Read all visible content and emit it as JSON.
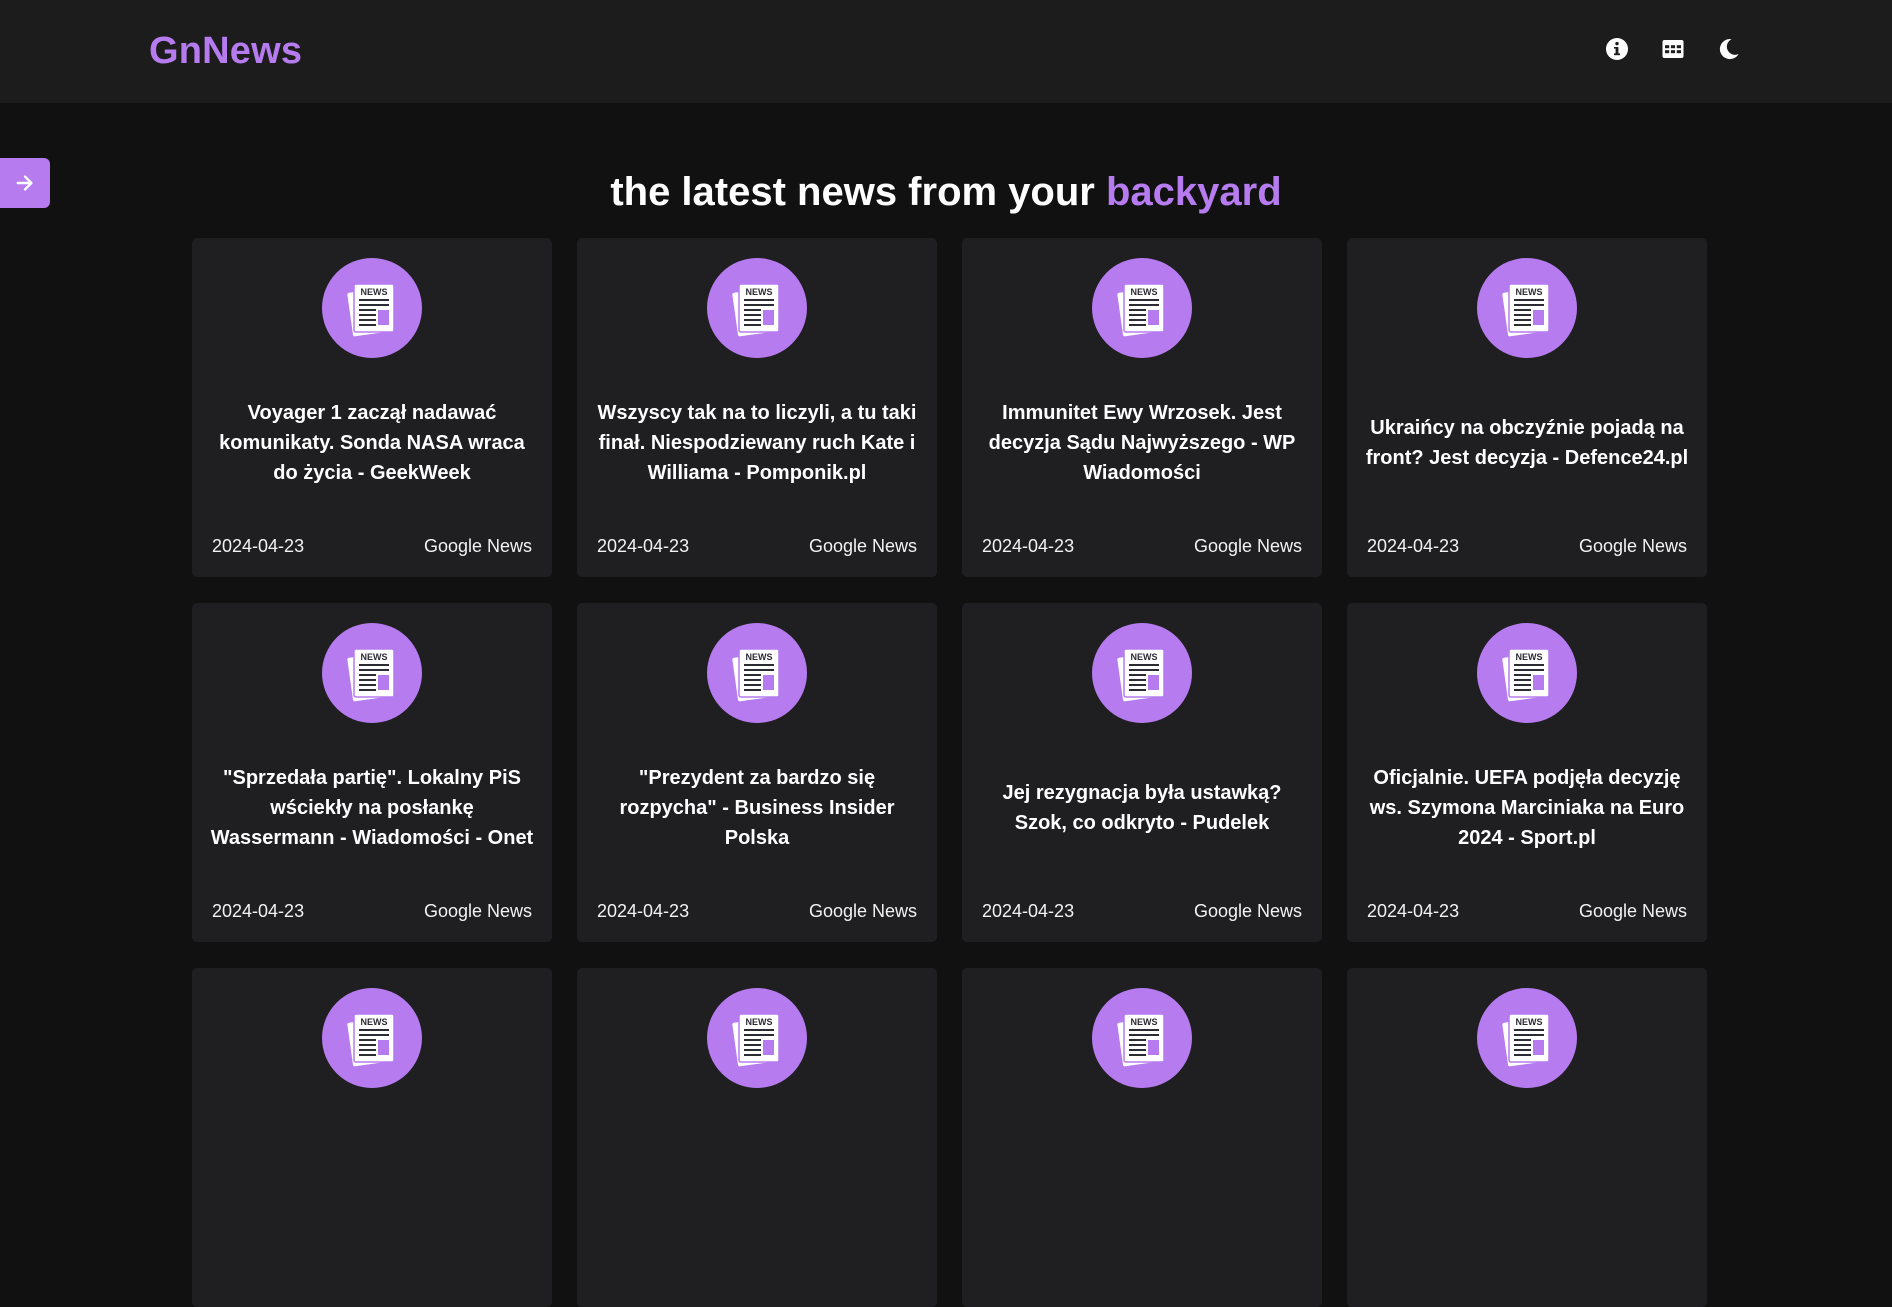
{
  "header": {
    "logo": "GnNews",
    "icons": [
      "info-icon",
      "grid-icon",
      "moon-icon"
    ]
  },
  "colors": {
    "accent": "#b57bef",
    "background": "#111112",
    "card": "#1f1f21",
    "topbar": "#1c1c1d"
  },
  "headline": {
    "text": "the latest news from your",
    "accent": "backyard"
  },
  "articles": [
    {
      "badge": "NEWS",
      "title": "Voyager 1 zaczął nadawać komunikaty. Sonda NASA wraca do życia - GeekWeek",
      "date": "2024-04-23",
      "source": "Google News"
    },
    {
      "badge": "NEWS",
      "title": "Wszyscy tak na to liczyli, a tu taki finał. Niespodziewany ruch Kate i Williama - Pomponik.pl",
      "date": "2024-04-23",
      "source": "Google News"
    },
    {
      "badge": "NEWS",
      "title": "Immunitet Ewy Wrzosek. Jest decyzja Sądu Najwyższego - WP Wiadomości",
      "date": "2024-04-23",
      "source": "Google News"
    },
    {
      "badge": "NEWS",
      "title": "Ukraińcy na obczyźnie pojadą na front? Jest decyzja - Defence24.pl",
      "date": "2024-04-23",
      "source": "Google News"
    },
    {
      "badge": "NEWS",
      "title": "\"Sprzedała partię\". Lokalny PiS wściekły na posłankę Wassermann - Wiadomości - Onet",
      "date": "2024-04-23",
      "source": "Google News"
    },
    {
      "badge": "NEWS",
      "title": "\"Prezydent za bardzo się rozpycha\" - Business Insider Polska",
      "date": "2024-04-23",
      "source": "Google News"
    },
    {
      "badge": "NEWS",
      "title": "Jej rezygnacja była ustawką? Szok, co odkryto - Pudelek",
      "date": "2024-04-23",
      "source": "Google News"
    },
    {
      "badge": "NEWS",
      "title": "Oficjalnie. UEFA podjęła decyzję ws. Szymona Marciniaka na Euro 2024 - Sport.pl",
      "date": "2024-04-23",
      "source": "Google News"
    },
    {
      "badge": "NEWS",
      "title": "",
      "date": "",
      "source": ""
    },
    {
      "badge": "NEWS",
      "title": "",
      "date": "",
      "source": ""
    },
    {
      "badge": "NEWS",
      "title": "",
      "date": "",
      "source": ""
    },
    {
      "badge": "NEWS",
      "title": "",
      "date": "",
      "source": ""
    }
  ]
}
